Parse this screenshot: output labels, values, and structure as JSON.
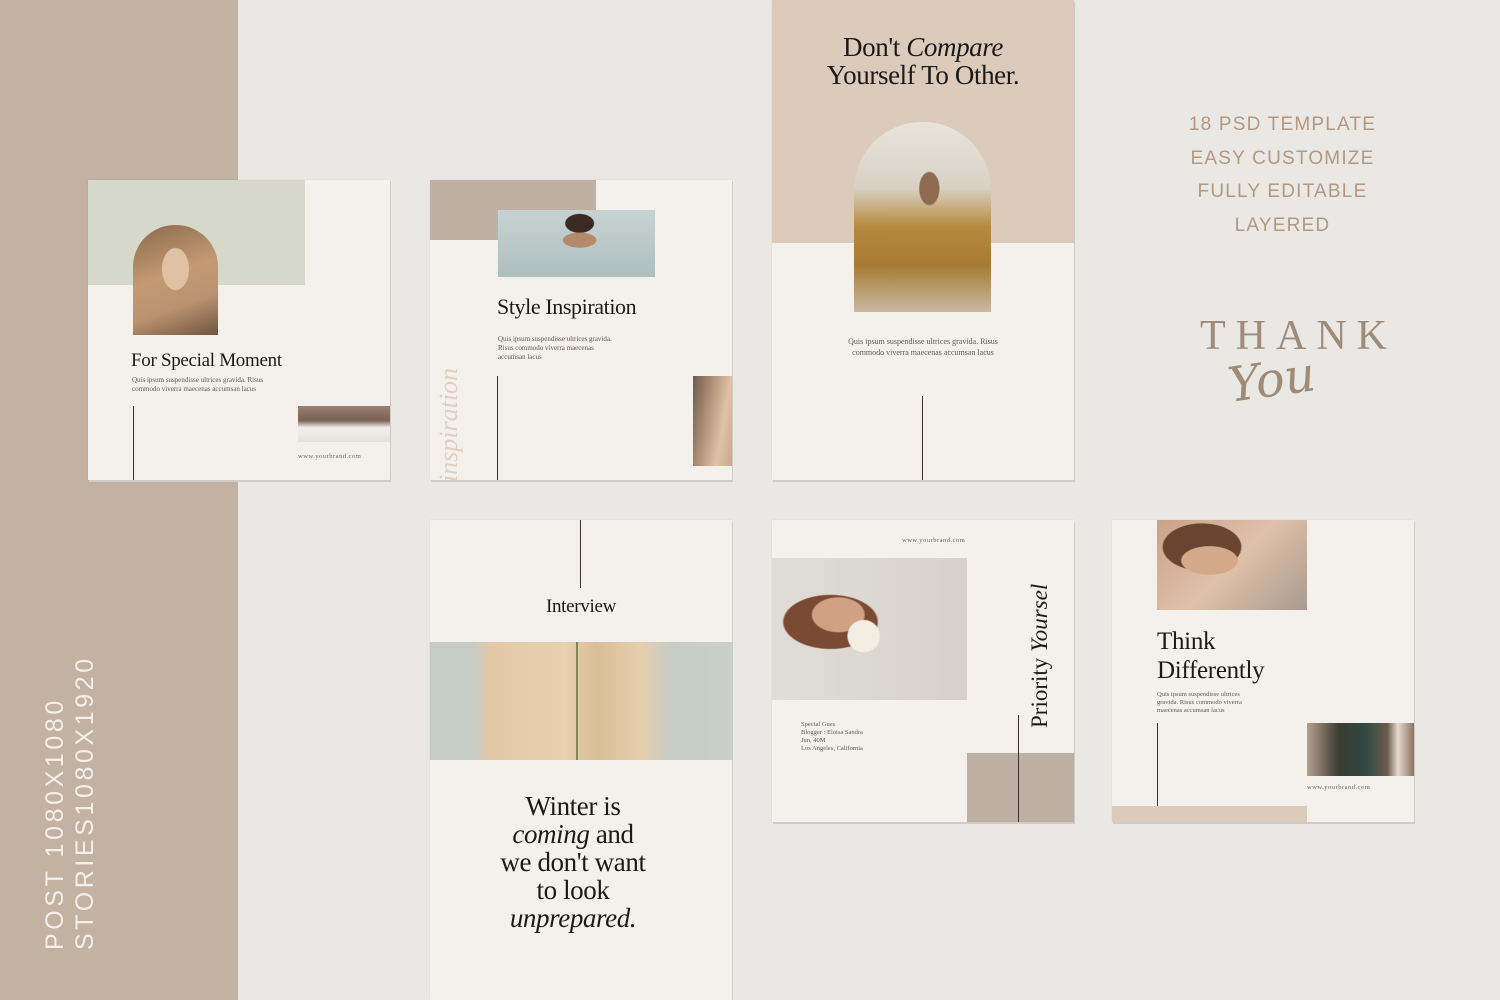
{
  "side": {
    "line1": "POST 1080X1080",
    "line2": "STORIES1080X1920"
  },
  "features": [
    "18 PSD TEMPLATE",
    "EASY CUSTOMIZE",
    "FULLY EDITABLE",
    "LAYERED"
  ],
  "thank_you": {
    "thank": "THANK",
    "you": "You"
  },
  "card1": {
    "title": "For Special Moment",
    "body": "Quis ipsum suspendisse ultrices gravida. Risus commodo viverra maecenas accumsan lacus",
    "url": "www.yourbrand.com"
  },
  "card2": {
    "title": "Style Inspiration",
    "body": "Quis ipsum suspendisse ultrices gravida. Risus commodo viverra maecenas accumsan lacus",
    "vertical": "inspiration"
  },
  "card3": {
    "title_a": "Don't",
    "title_b": "Compare",
    "title_c": "Yourself To Other.",
    "body": "Quis ipsum suspendisse ultrices gravida. Risus commodo viverra maecenas accumsan lacus"
  },
  "card4": {
    "title": "Interview",
    "q1": "Winter is",
    "q2a": "coming",
    "q2b": " and",
    "q3": "we don't want",
    "q4": "to look",
    "q5": "unprepared."
  },
  "card5": {
    "url": "www.yourbrand.com",
    "vertical_a": "Priority ",
    "vertical_b": "Yoursel",
    "info": [
      "Special Gues",
      "Blogger : Eloisa Sandra",
      "Jun, 40M",
      "Los Angeles, California"
    ]
  },
  "card6": {
    "title1": "Think",
    "title2": "Differently",
    "body": "Quis ipsum suspendisse ultrices gravida. Risus commodo viverra maecenas accumsan lacus",
    "url": "www.yourbrand.com"
  }
}
